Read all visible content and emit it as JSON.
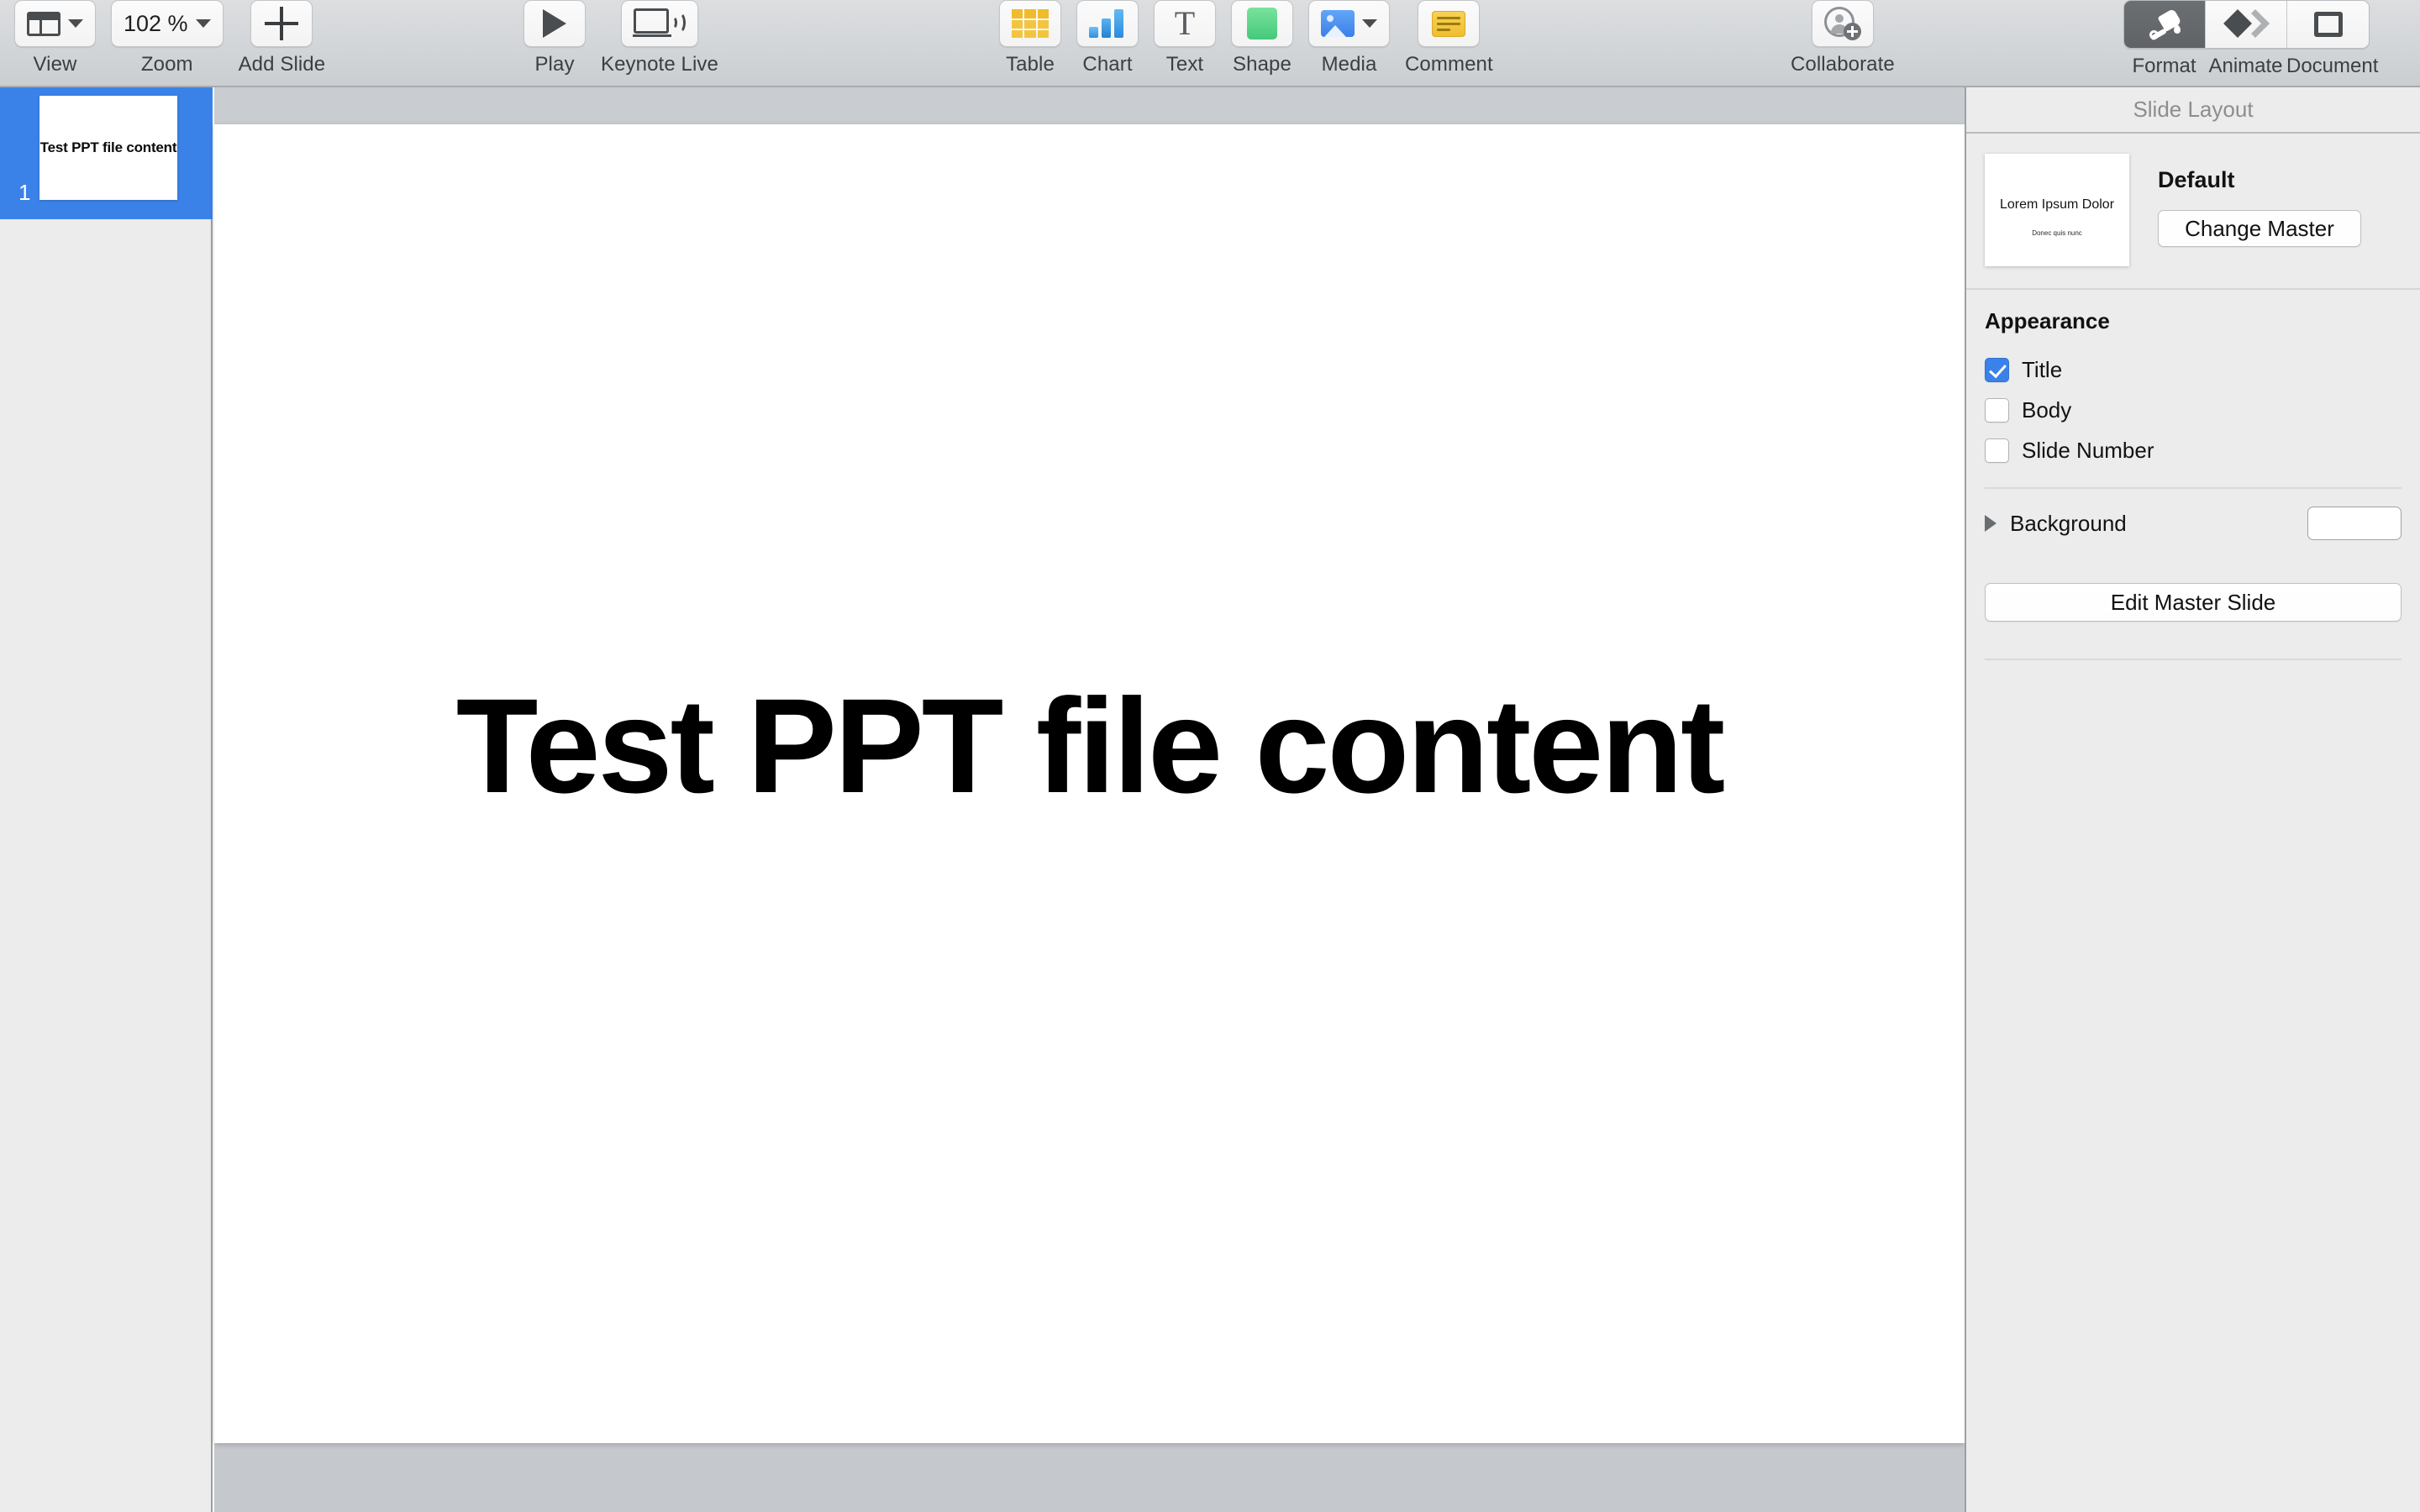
{
  "toolbar": {
    "view": {
      "label": "View",
      "icon": "window-layout-icon",
      "has_menu": true
    },
    "zoom": {
      "label": "Zoom",
      "value": "102 %",
      "has_menu": true
    },
    "add_slide": {
      "label": "Add Slide",
      "icon": "plus-icon"
    },
    "play": {
      "label": "Play",
      "icon": "play-icon"
    },
    "keynote_live": {
      "label": "Keynote Live",
      "icon": "broadcast-display-icon"
    },
    "table": {
      "label": "Table",
      "icon": "table-icon"
    },
    "chart": {
      "label": "Chart",
      "icon": "bar-chart-icon"
    },
    "text": {
      "label": "Text",
      "icon": "text-t-icon"
    },
    "shape": {
      "label": "Shape",
      "icon": "shape-square-icon"
    },
    "media": {
      "label": "Media",
      "icon": "media-photo-icon",
      "has_menu": true
    },
    "comment": {
      "label": "Comment",
      "icon": "comment-note-icon"
    },
    "collaborate": {
      "label": "Collaborate",
      "icon": "add-person-icon"
    },
    "format": {
      "label": "Format",
      "icon": "paintbrush-icon",
      "selected": true
    },
    "animate": {
      "label": "Animate",
      "icon": "animate-diamond-icon",
      "selected": false
    },
    "document": {
      "label": "Document",
      "icon": "document-square-icon",
      "selected": false
    }
  },
  "navigator": {
    "slides": [
      {
        "number": "1",
        "thumb_text": "Test PPT file content",
        "selected": true
      }
    ]
  },
  "canvas": {
    "slide_title": "Test PPT file content"
  },
  "inspector": {
    "header": "Slide Layout",
    "master": {
      "thumb_title": "Lorem Ipsum Dolor",
      "thumb_subtitle": "Donec quis nunc",
      "name": "Default",
      "change_master_label": "Change Master"
    },
    "appearance": {
      "title": "Appearance",
      "options": [
        {
          "label": "Title",
          "checked": true
        },
        {
          "label": "Body",
          "checked": false
        },
        {
          "label": "Slide Number",
          "checked": false
        }
      ]
    },
    "background": {
      "label": "Background",
      "expanded": false,
      "color": "#ffffff"
    },
    "edit_master_label": "Edit Master Slide"
  },
  "colors": {
    "accent": "#3b82e8",
    "toolbar_bg": "#d3d6d9",
    "canvas_bg": "#c7cacf",
    "panel_bg": "#ececec",
    "selected_tool_bg": "#64676a"
  }
}
